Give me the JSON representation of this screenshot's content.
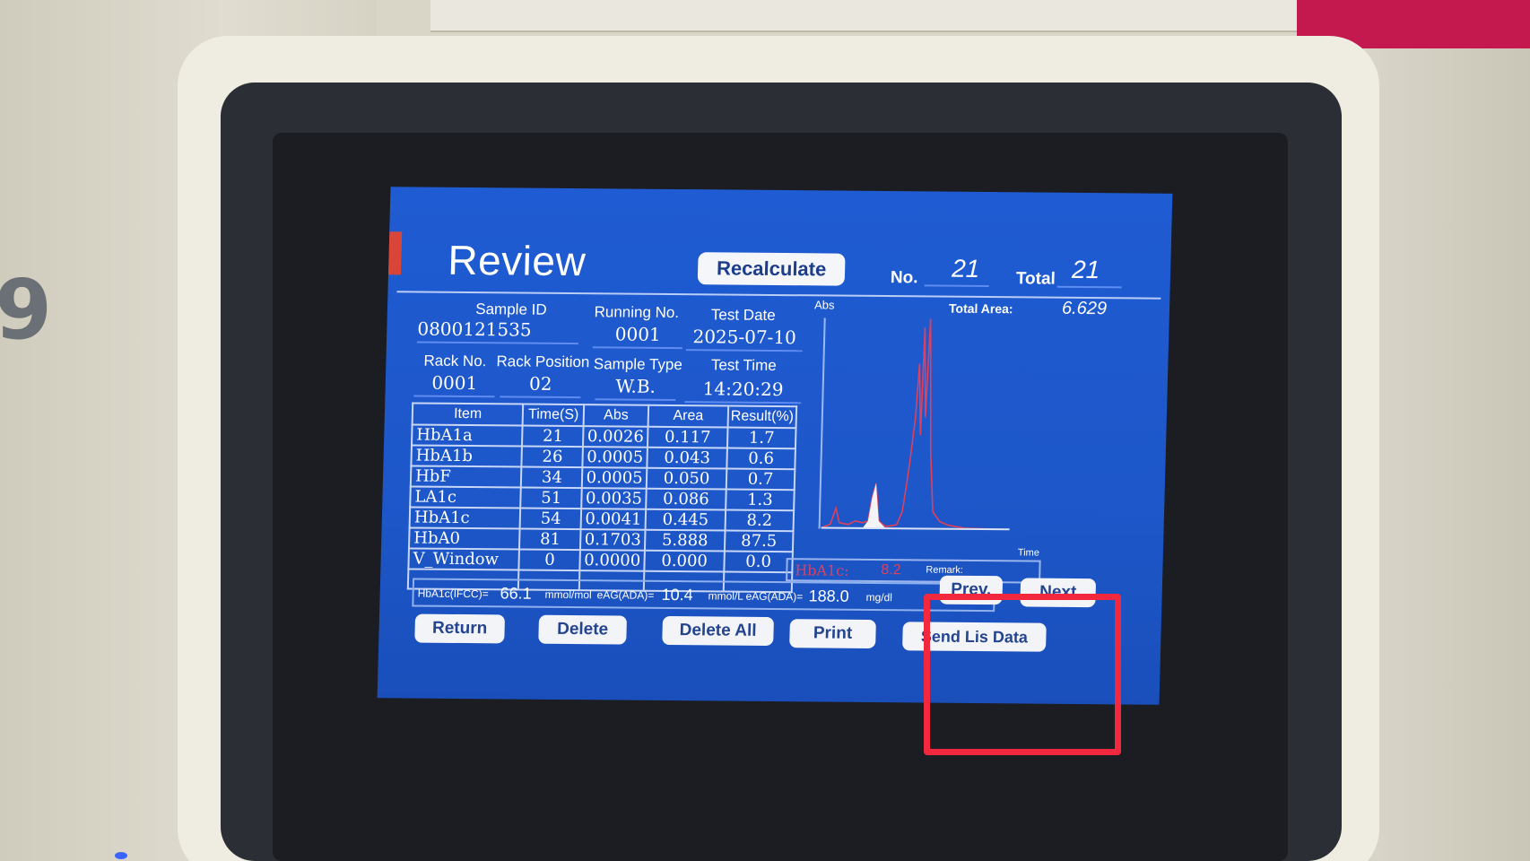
{
  "device": {
    "side_digit": "9"
  },
  "header": {
    "title": "Review",
    "recalculate_label": "Recalculate",
    "no_label": "No.",
    "no_value": "21",
    "total_label": "Total",
    "total_value": "21"
  },
  "sample": {
    "sample_id_label": "Sample ID",
    "sample_id": "0800121535",
    "running_no_label": "Running No.",
    "running_no": "0001",
    "test_date_label": "Test Date",
    "test_date": "2025-07-10",
    "rack_no_label": "Rack No.",
    "rack_no": "0001",
    "rack_position_label": "Rack Position",
    "rack_position": "02",
    "sample_type_label": "Sample Type",
    "sample_type": "W.B.",
    "test_time_label": "Test Time",
    "test_time": "14:20:29"
  },
  "table": {
    "headers": [
      "Item",
      "Time(S)",
      "Abs",
      "Area",
      "Result(%)"
    ],
    "rows": [
      [
        "HbA1a",
        "21",
        "0.0026",
        "0.117",
        "1.7"
      ],
      [
        "HbA1b",
        "26",
        "0.0005",
        "0.043",
        "0.6"
      ],
      [
        "HbF",
        "34",
        "0.0005",
        "0.050",
        "0.7"
      ],
      [
        "LA1c",
        "51",
        "0.0035",
        "0.086",
        "1.3"
      ],
      [
        "HbA1c",
        "54",
        "0.0041",
        "0.445",
        "8.2"
      ],
      [
        "HbA0",
        "81",
        "0.1703",
        "5.888",
        "87.5"
      ],
      [
        "V_Window",
        "0",
        "0.0000",
        "0.000",
        "0.0"
      ]
    ]
  },
  "chart": {
    "y_label": "Abs",
    "x_label": "Time",
    "total_area_label": "Total Area:",
    "total_area": "6.629",
    "hba1c_label": "HbA1c:",
    "hba1c_value": "8.2",
    "remark_label": "Remark:"
  },
  "footer": {
    "ifcc_label": "HbA1c(IFCC)=",
    "ifcc_value": "66.1",
    "ifcc_unit": "mmol/mol",
    "eag1_label": "eAG(ADA)=",
    "eag1_value": "10.4",
    "eag1_unit": "mmol/L",
    "eag2_label": "eAG(ADA)=",
    "eag2_value": "188.0",
    "eag2_unit": "mg/dl"
  },
  "buttons": {
    "prev": "Prev.",
    "next": "Next",
    "return": "Return",
    "delete": "Delete",
    "delete_all": "Delete All",
    "print": "Print",
    "send_lis": "Send Lis Data"
  },
  "colors": {
    "screen_blue": "#1f5bd2",
    "highlight_red": "#f2283f",
    "trace_red": "#e0405a"
  }
}
